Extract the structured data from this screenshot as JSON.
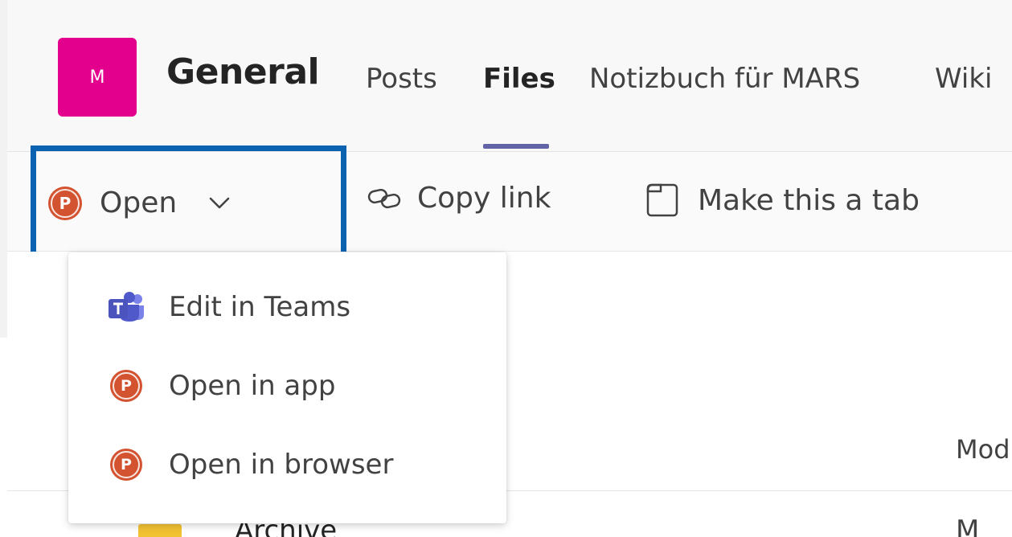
{
  "channel": {
    "avatar_letter": "M",
    "title": "General"
  },
  "tabs": [
    {
      "label": "Posts",
      "active": false
    },
    {
      "label": "Files",
      "active": true
    },
    {
      "label": "Notizbuch für MARS",
      "active": false
    },
    {
      "label": "Wiki",
      "active": false
    }
  ],
  "toolbar": {
    "open_label": "Open",
    "copy_link_label": "Copy link",
    "make_tab_label": "Make this a tab"
  },
  "open_menu": {
    "items": [
      {
        "label": "Edit in Teams",
        "icon": "teams-icon"
      },
      {
        "label": "Open in app",
        "icon": "powerpoint-icon"
      },
      {
        "label": "Open in browser",
        "icon": "powerpoint-icon"
      }
    ]
  },
  "file_list": {
    "modified_header": "Modified",
    "first_row": {
      "name": "Archive",
      "modified": "M"
    }
  },
  "colors": {
    "avatar": "#e3008c",
    "accent": "#6264a7",
    "highlight": "#0a62b0",
    "powerpoint": "#d35230",
    "teams": "#5059c9"
  }
}
